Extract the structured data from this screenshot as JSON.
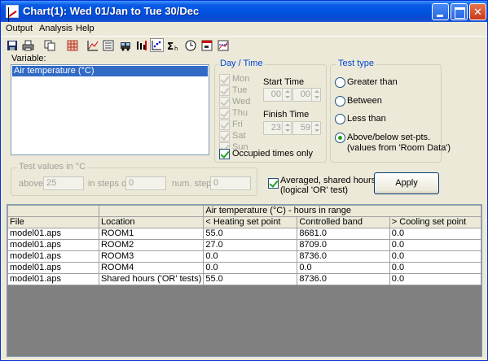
{
  "window": {
    "title": "Chart(1): Wed 01/Jan to Tue 30/Dec"
  },
  "menu": [
    "Output",
    "Analysis",
    "Help"
  ],
  "toolbar": [
    "save-icon",
    "print-icon",
    "copy-icon",
    "table-icon",
    "line-chart-icon",
    "list-icon",
    "bus-icon",
    "bar-marker-icon",
    "scatter-icon",
    "sigma-icon",
    "clock-icon",
    "window-icon",
    "chart-line-icon"
  ],
  "variable": {
    "label": "Variable:",
    "items": [
      "Air temperature (°C)"
    ]
  },
  "day_time": {
    "title": "Day / Time",
    "days": [
      "Mon",
      "Tue",
      "Wed",
      "Thu",
      "Fri",
      "Sat",
      "Sun"
    ],
    "start_label": "Start Time",
    "start_hour": "00",
    "start_min": "00",
    "finish_label": "Finish Time",
    "finish_hour": "23",
    "finish_min": "59",
    "occupied_label": "Occupied times only"
  },
  "test_type": {
    "title": "Test type",
    "options": [
      "Greater than",
      "Between",
      "Less than",
      "Above/below set-pts.",
      "(values from 'Room Data')"
    ],
    "selected": "Above/below set-pts."
  },
  "test_values": {
    "title": "Test values in °C",
    "above_label": "above",
    "above_value": "25",
    "steps_label": "in steps of",
    "steps_value": "0",
    "num_label": "num. steps",
    "num_value": "0"
  },
  "averaged": {
    "line1": "Averaged, shared hours",
    "line2": "(logical 'OR' test)"
  },
  "apply_label": "Apply",
  "grid": {
    "group_header": "Air temperature (°C) - hours in range",
    "columns": [
      "File",
      "Location",
      "< Heating set point",
      "Controlled band",
      "> Cooling set point"
    ],
    "rows": [
      [
        "model01.aps",
        "ROOM1",
        "55.0",
        "8681.0",
        "0.0"
      ],
      [
        "model01.aps",
        "ROOM2",
        "27.0",
        "8709.0",
        "0.0"
      ],
      [
        "model01.aps",
        "ROOM3",
        "0.0",
        "8736.0",
        "0.0"
      ],
      [
        "model01.aps",
        "ROOM4",
        "0.0",
        "0.0",
        "0.0"
      ],
      [
        "model01.aps",
        "Shared hours ('OR' tests)",
        "55.0",
        "8736.0",
        "0.0"
      ]
    ]
  }
}
